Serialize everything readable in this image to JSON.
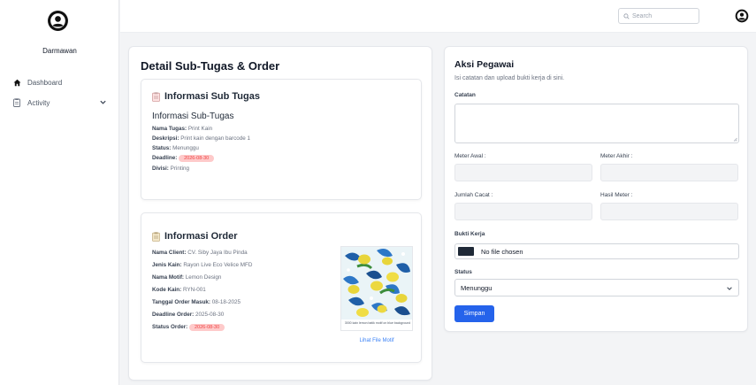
{
  "sidebar": {
    "username": "Darmawan",
    "items": [
      {
        "label": "Dashboard",
        "icon": "home-icon"
      },
      {
        "label": "Activity",
        "icon": "clipboard-icon"
      }
    ]
  },
  "topbar": {
    "search_placeholder": "Search"
  },
  "detail": {
    "title": "Detail Sub-Tugas & Order",
    "sub_tugas": {
      "heading": "Informasi Sub Tugas",
      "subheading": "Informasi Sub-Tugas",
      "fields": [
        {
          "label": "Nama Tugas:",
          "value": "Print Kain"
        },
        {
          "label": "Deskripsi:",
          "value": "Print kain dengan barcode 1"
        },
        {
          "label": "Status:",
          "value": "Menunggu"
        },
        {
          "label": "Deadline:",
          "value": "2026-08-30"
        },
        {
          "label": "Divisi:",
          "value": "Printing"
        }
      ]
    },
    "order": {
      "heading": "Informasi Order",
      "fields": [
        {
          "label": "Nama Client:",
          "value": "CV. Siby Jaya Ibu Pinda"
        },
        {
          "label": "Jenis Kain:",
          "value": "Rayon Live Eco Velice MFD"
        },
        {
          "label": "Nama Motif:",
          "value": "Lemon Design"
        },
        {
          "label": "Kode Kain:",
          "value": "RYN-001"
        },
        {
          "label": "Tanggal Order Masuk:",
          "value": "08-18-2025"
        },
        {
          "label": "Deadline Order:",
          "value": "2025-08-30"
        },
        {
          "label": "Status Order:",
          "value": "2026-08-30"
        }
      ],
      "motif_caption": "3000 kain lemon batik motif on blue background",
      "motif_link": "Lihat File Motif"
    }
  },
  "aksi": {
    "title": "Aksi Pegawai",
    "description": "Isi catatan dan upload bukti kerja di sini.",
    "catatan_label": "Catatan",
    "meter_awal_label": "Meter Awal :",
    "meter_akhir_label": "Meter Akhir :",
    "jumlah_cacat_label": "Jumlah Cacat :",
    "hasil_meter_label": "Hasil Meter :",
    "bukti_label": "Bukti Kerja",
    "file_status": "No file chosen",
    "status_label": "Status",
    "status_value": "Menunggu",
    "save_label": "Simpan"
  },
  "colors": {
    "accent": "#2563eb",
    "badge_bg": "#fecaca",
    "badge_text": "#ef4444",
    "page_bg": "#f3f4f6"
  }
}
